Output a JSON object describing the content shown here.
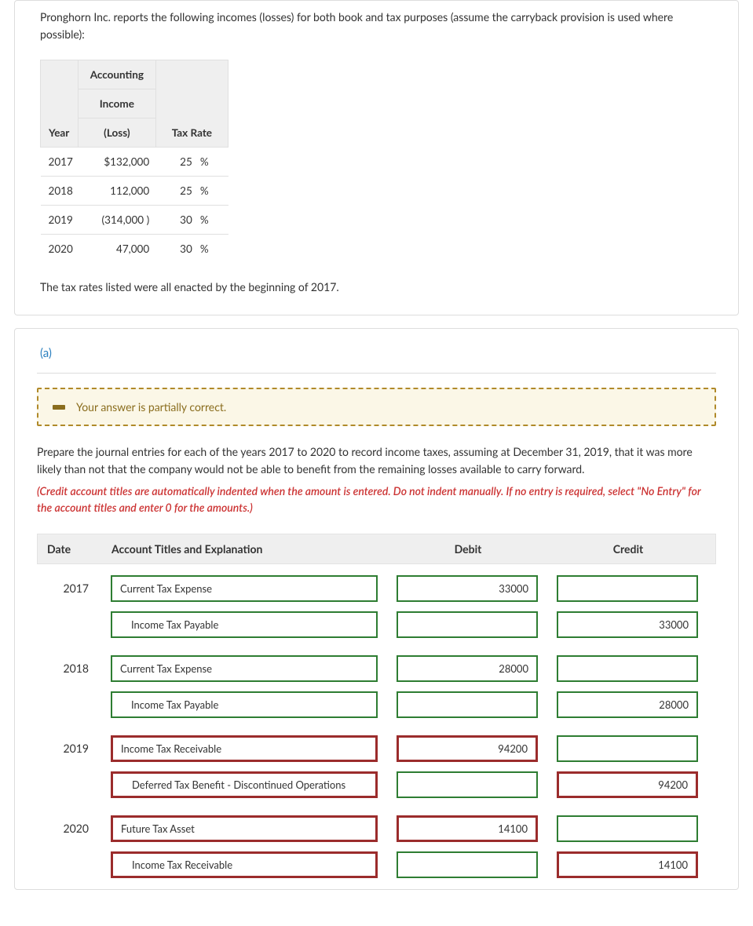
{
  "intro": "Pronghorn Inc. reports the following incomes (losses) for both book and tax purposes (assume the carryback provision is used where possible):",
  "income_table": {
    "headers": {
      "year": "Year",
      "income_line1": "Accounting",
      "income_line2": "Income",
      "income_line3": "(Loss)",
      "rate": "Tax Rate"
    },
    "rows": [
      {
        "year": "2017",
        "amount": "$132,000",
        "rate": "25",
        "pct": "%"
      },
      {
        "year": "2018",
        "amount": "112,000",
        "rate": "25",
        "pct": "%"
      },
      {
        "year": "2019",
        "amount": "(314,000   )",
        "rate": "30",
        "pct": "%"
      },
      {
        "year": "2020",
        "amount": "47,000",
        "rate": "30",
        "pct": "%"
      }
    ]
  },
  "note": "The tax rates listed were all enacted by the beginning of 2017.",
  "section_label": "(a)",
  "feedback": "Your answer is partially correct.",
  "instructions": "Prepare the journal entries for each of the years 2017 to 2020 to record income taxes, assuming at December 31, 2019, that it was more likely than not that the company would not be able to benefit from the remaining losses available to carry forward.",
  "instructions_red": "(Credit account titles are automatically indented when the amount is entered. Do not indent manually. If no entry is required, select \"No Entry\" for the account titles and enter 0 for the amounts.)",
  "je": {
    "headers": {
      "date": "Date",
      "account": "Account Titles and Explanation",
      "debit": "Debit",
      "credit": "Credit"
    },
    "rows": [
      {
        "year": "2017",
        "account": "Current Tax Expense",
        "debit": "33000",
        "credit": "",
        "indent": false,
        "acct_style": "green",
        "debit_style": "green",
        "credit_style": "green"
      },
      {
        "year": "",
        "account": "Income Tax Payable",
        "debit": "",
        "credit": "33000",
        "indent": true,
        "acct_style": "green",
        "debit_style": "green",
        "credit_style": "green"
      },
      {
        "year": "2018",
        "account": "Current Tax Expense",
        "debit": "28000",
        "credit": "",
        "indent": false,
        "acct_style": "green",
        "debit_style": "green",
        "credit_style": "green"
      },
      {
        "year": "",
        "account": "Income Tax Payable",
        "debit": "",
        "credit": "28000",
        "indent": true,
        "acct_style": "green",
        "debit_style": "green",
        "credit_style": "green"
      },
      {
        "year": "2019",
        "account": "Income Tax Receivable",
        "debit": "94200",
        "credit": "",
        "indent": false,
        "acct_style": "red",
        "debit_style": "red",
        "credit_style": "green"
      },
      {
        "year": "",
        "account": "Deferred Tax Benefit - Discontinued Operations",
        "debit": "",
        "credit": "94200",
        "indent": true,
        "acct_style": "red",
        "debit_style": "green",
        "credit_style": "red"
      },
      {
        "year": "2020",
        "account": "Future Tax Asset",
        "debit": "14100",
        "credit": "",
        "indent": false,
        "acct_style": "red",
        "debit_style": "red",
        "credit_style": "green"
      },
      {
        "year": "",
        "account": "Income Tax Receivable",
        "debit": "",
        "credit": "14100",
        "indent": true,
        "acct_style": "red",
        "debit_style": "green",
        "credit_style": "red"
      }
    ]
  }
}
